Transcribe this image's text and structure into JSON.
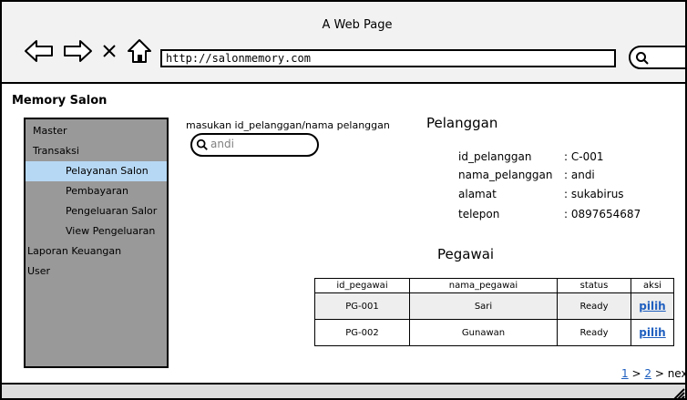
{
  "window": {
    "title": "A Web Page",
    "url": "http://salonmemory.com"
  },
  "app": {
    "title": "Memory Salon"
  },
  "sidebar": {
    "items": [
      {
        "label": "Master"
      },
      {
        "label": "Transaksi"
      },
      {
        "label": "Pelayanan Salon"
      },
      {
        "label": "Pembayaran"
      },
      {
        "label": "Pengeluaran Salor"
      },
      {
        "label": "View Pengeluaran"
      },
      {
        "label": "Laporan Keuangan"
      },
      {
        "label": "User"
      }
    ]
  },
  "search": {
    "label": "masukan id_pelanggan/nama pelanggan",
    "value": "andi"
  },
  "customer": {
    "title": "Pelanggan",
    "fields": [
      {
        "key": "id_pelanggan",
        "value": ": C-001"
      },
      {
        "key": "nama_pelanggan",
        "value": ": andi"
      },
      {
        "key": "alamat",
        "value": ": sukabirus"
      },
      {
        "key": "telepon",
        "value": ": 0897654687"
      }
    ]
  },
  "employees": {
    "title": "Pegawai",
    "headers": [
      "id_pegawai",
      "nama_pegawai",
      "status",
      "aksi"
    ],
    "rows": [
      {
        "id": "PG-001",
        "name": "Sari",
        "status": "Ready",
        "action": "pilih"
      },
      {
        "id": "PG-002",
        "name": "Gunawan",
        "status": "Ready",
        "action": "pilih"
      }
    ]
  },
  "pagination": {
    "page1": "1",
    "sep1": ">",
    "page2": "2",
    "next": "> next"
  },
  "colors": {
    "sidebar_bg": "#999999",
    "active_item": "#b7d8f4",
    "link": "#1f5fbf"
  },
  "icons": [
    "back-arrow-icon",
    "forward-arrow-icon",
    "close-icon",
    "home-icon",
    "search-icon",
    "resize-grip-icon"
  ]
}
